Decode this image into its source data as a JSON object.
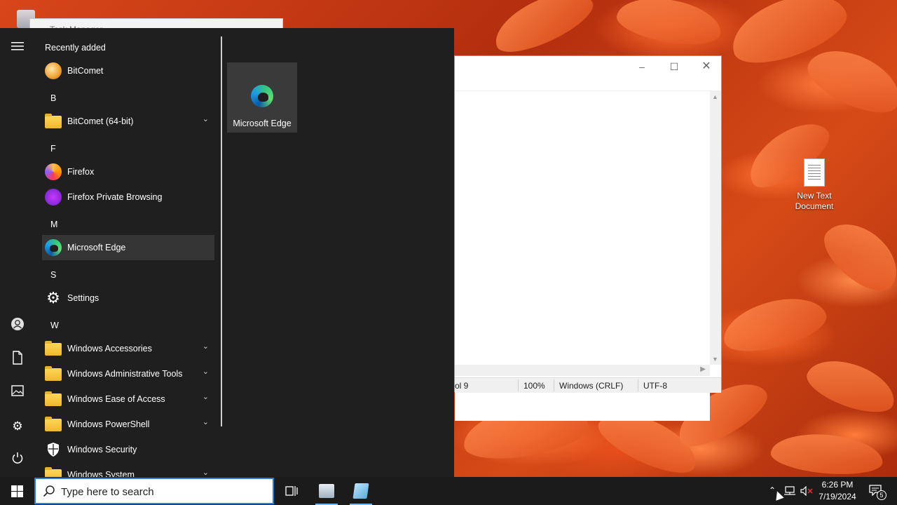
{
  "background_window": {
    "title": "Task Manager"
  },
  "start_menu": {
    "rail": [
      "menu-icon",
      "user-icon",
      "document-icon",
      "pictures-icon",
      "settings-icon",
      "power-icon"
    ],
    "sections": {
      "recently_added": "Recently added",
      "b": "B",
      "f": "F",
      "m": "M",
      "s": "S",
      "w": "W"
    },
    "apps": {
      "bitcomet": "BitComet",
      "bitcomet64": "BitComet (64-bit)",
      "firefox": "Firefox",
      "firefox_private": "Firefox Private Browsing",
      "edge": "Microsoft Edge",
      "settings": "Settings",
      "win_accessories": "Windows Accessories",
      "win_admin": "Windows Administrative Tools",
      "win_ease": "Windows Ease of Access",
      "win_ps": "Windows PowerShell",
      "win_security": "Windows Security",
      "win_system": "Windows System"
    },
    "pinned_tiles": [
      {
        "label": "Microsoft Edge"
      }
    ]
  },
  "notepad": {
    "status": {
      "position": "ol 9",
      "zoom": "100%",
      "line_ending": "Windows (CRLF)",
      "encoding": "UTF-8"
    }
  },
  "desktop": {
    "icons": [
      {
        "label": "New Text Document"
      }
    ]
  },
  "taskbar": {
    "search_placeholder": "Type here to search",
    "time": "6:26 PM",
    "date": "7/19/2024",
    "notification_count": "5"
  }
}
